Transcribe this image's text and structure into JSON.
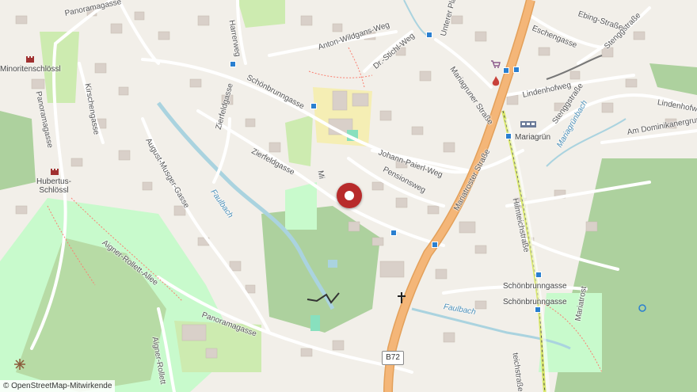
{
  "map": {
    "attribution": "© OpenStreetMap-Mitwirkende",
    "route_shield": "B72",
    "places": [
      {
        "id": "minoritenschloessl",
        "text": "Minoritenschlössl"
      },
      {
        "id": "hubertus",
        "text": "Hubertus-\nSchlössl"
      },
      {
        "id": "mariagrun",
        "text": "Mariagrün"
      },
      {
        "id": "schoenbrunngasse-stop-1",
        "text": "Schönbrunngasse"
      },
      {
        "id": "schoenbrunngasse-stop-2",
        "text": "Schönbrunngasse"
      }
    ],
    "streets": [
      {
        "id": "panoramagasse-top",
        "text": "Panoramagasse"
      },
      {
        "id": "harrerweg",
        "text": "Harrerweg"
      },
      {
        "id": "anton-wildgans-weg",
        "text": "Anton-Wildgans-Weg"
      },
      {
        "id": "dr-stichl-weg",
        "text": "Dr.-Stichl-Weg"
      },
      {
        "id": "unterer-plattenweg",
        "text": "Unterer Pla"
      },
      {
        "id": "eschengasse",
        "text": "Eschengasse"
      },
      {
        "id": "ebing-strasse",
        "text": "Ebing-Straße"
      },
      {
        "id": "stenggstrasse",
        "text": "Stenggstraße"
      },
      {
        "id": "mariagruner-strasse",
        "text": "Mariagruner Straße"
      },
      {
        "id": "lindenhofweg",
        "text": "Lindenhofweg"
      },
      {
        "id": "stenggstrasse-2",
        "text": "Stenggstraße"
      },
      {
        "id": "lindenhofweg-2",
        "text": "Lindenhofw"
      },
      {
        "id": "am-dominikanergrund",
        "text": "Am Dominikanergrund"
      },
      {
        "id": "schoenbrunngasse",
        "text": "Schönbrunngasse"
      },
      {
        "id": "kirschengasse",
        "text": "Kirschengasse"
      },
      {
        "id": "panoramagasse-left",
        "text": "Panoramagasse"
      },
      {
        "id": "zierfeldgasse-1",
        "text": "Zierfeldgasse"
      },
      {
        "id": "zierfeldgasse-2",
        "text": "Zierfeldgasse"
      },
      {
        "id": "august-musger-gasse",
        "text": "August-Musger-Gasse"
      },
      {
        "id": "johann-paierl-weg",
        "text": "Johann-Paierl-Weg"
      },
      {
        "id": "pensionsweg",
        "text": "Pensionsweg"
      },
      {
        "id": "mariatroster-strasse",
        "text": "Mariatroster Straße"
      },
      {
        "id": "hilmteichstrasse",
        "text": "Hilmteichstraße"
      },
      {
        "id": "aigner-rollett-allee",
        "text": "Aigner-Rollett-Allee"
      },
      {
        "id": "panoramagasse-bottom",
        "text": "Panoramagasse"
      },
      {
        "id": "aigner-rollett-2",
        "text": "Aigner-Rollett"
      },
      {
        "id": "teichstrasse",
        "text": "teichstraße"
      },
      {
        "id": "mariatrost-lower",
        "text": "Mariatrost"
      },
      {
        "id": "mi",
        "text": "Mi"
      }
    ],
    "waterways": [
      {
        "id": "faulbach-1",
        "text": "Faulbach"
      },
      {
        "id": "faulbach-2",
        "text": "Faulbach"
      },
      {
        "id": "mariagrunbach",
        "text": "Mariagrünbach"
      }
    ],
    "icons": [
      "castle-icon",
      "church-cross-icon",
      "fire-station-icon",
      "shopping-cart-icon",
      "train-station-icon",
      "viewpoint-icon",
      "location-marker-icon"
    ],
    "colors": {
      "background": "#f2efe9",
      "primary_road": "#f4b678",
      "residential_road": "#ffffff",
      "forest": "#add19e",
      "park": "#c8facc",
      "school": "#f5eeb4",
      "water": "#aad3df",
      "marker": "#b82b2b",
      "tram_line": "#d8e86a"
    }
  }
}
